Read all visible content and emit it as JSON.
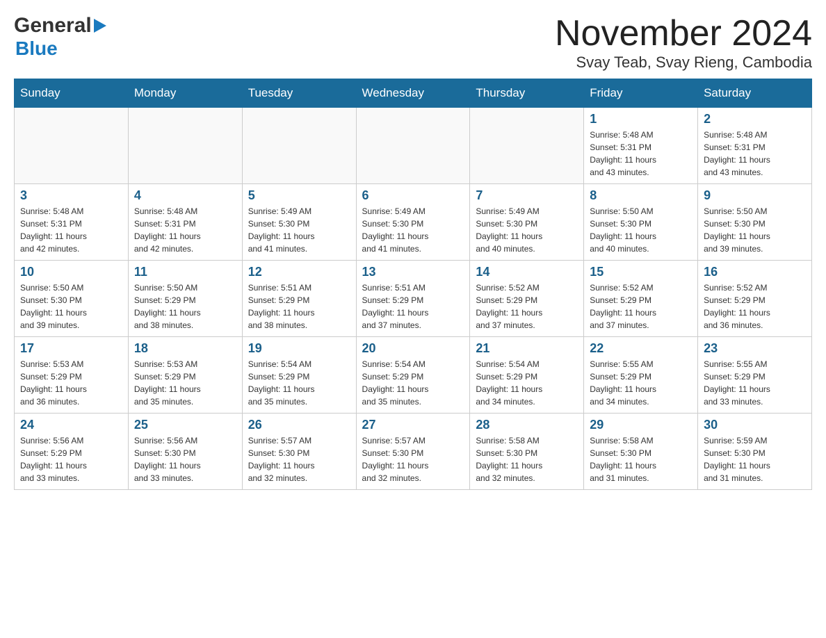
{
  "header": {
    "logo_general": "General",
    "logo_blue": "Blue",
    "title": "November 2024",
    "subtitle": "Svay Teab, Svay Rieng, Cambodia"
  },
  "calendar": {
    "days_of_week": [
      "Sunday",
      "Monday",
      "Tuesday",
      "Wednesday",
      "Thursday",
      "Friday",
      "Saturday"
    ],
    "weeks": [
      [
        {
          "day": "",
          "info": ""
        },
        {
          "day": "",
          "info": ""
        },
        {
          "day": "",
          "info": ""
        },
        {
          "day": "",
          "info": ""
        },
        {
          "day": "",
          "info": ""
        },
        {
          "day": "1",
          "info": "Sunrise: 5:48 AM\nSunset: 5:31 PM\nDaylight: 11 hours\nand 43 minutes."
        },
        {
          "day": "2",
          "info": "Sunrise: 5:48 AM\nSunset: 5:31 PM\nDaylight: 11 hours\nand 43 minutes."
        }
      ],
      [
        {
          "day": "3",
          "info": "Sunrise: 5:48 AM\nSunset: 5:31 PM\nDaylight: 11 hours\nand 42 minutes."
        },
        {
          "day": "4",
          "info": "Sunrise: 5:48 AM\nSunset: 5:31 PM\nDaylight: 11 hours\nand 42 minutes."
        },
        {
          "day": "5",
          "info": "Sunrise: 5:49 AM\nSunset: 5:30 PM\nDaylight: 11 hours\nand 41 minutes."
        },
        {
          "day": "6",
          "info": "Sunrise: 5:49 AM\nSunset: 5:30 PM\nDaylight: 11 hours\nand 41 minutes."
        },
        {
          "day": "7",
          "info": "Sunrise: 5:49 AM\nSunset: 5:30 PM\nDaylight: 11 hours\nand 40 minutes."
        },
        {
          "day": "8",
          "info": "Sunrise: 5:50 AM\nSunset: 5:30 PM\nDaylight: 11 hours\nand 40 minutes."
        },
        {
          "day": "9",
          "info": "Sunrise: 5:50 AM\nSunset: 5:30 PM\nDaylight: 11 hours\nand 39 minutes."
        }
      ],
      [
        {
          "day": "10",
          "info": "Sunrise: 5:50 AM\nSunset: 5:30 PM\nDaylight: 11 hours\nand 39 minutes."
        },
        {
          "day": "11",
          "info": "Sunrise: 5:50 AM\nSunset: 5:29 PM\nDaylight: 11 hours\nand 38 minutes."
        },
        {
          "day": "12",
          "info": "Sunrise: 5:51 AM\nSunset: 5:29 PM\nDaylight: 11 hours\nand 38 minutes."
        },
        {
          "day": "13",
          "info": "Sunrise: 5:51 AM\nSunset: 5:29 PM\nDaylight: 11 hours\nand 37 minutes."
        },
        {
          "day": "14",
          "info": "Sunrise: 5:52 AM\nSunset: 5:29 PM\nDaylight: 11 hours\nand 37 minutes."
        },
        {
          "day": "15",
          "info": "Sunrise: 5:52 AM\nSunset: 5:29 PM\nDaylight: 11 hours\nand 37 minutes."
        },
        {
          "day": "16",
          "info": "Sunrise: 5:52 AM\nSunset: 5:29 PM\nDaylight: 11 hours\nand 36 minutes."
        }
      ],
      [
        {
          "day": "17",
          "info": "Sunrise: 5:53 AM\nSunset: 5:29 PM\nDaylight: 11 hours\nand 36 minutes."
        },
        {
          "day": "18",
          "info": "Sunrise: 5:53 AM\nSunset: 5:29 PM\nDaylight: 11 hours\nand 35 minutes."
        },
        {
          "day": "19",
          "info": "Sunrise: 5:54 AM\nSunset: 5:29 PM\nDaylight: 11 hours\nand 35 minutes."
        },
        {
          "day": "20",
          "info": "Sunrise: 5:54 AM\nSunset: 5:29 PM\nDaylight: 11 hours\nand 35 minutes."
        },
        {
          "day": "21",
          "info": "Sunrise: 5:54 AM\nSunset: 5:29 PM\nDaylight: 11 hours\nand 34 minutes."
        },
        {
          "day": "22",
          "info": "Sunrise: 5:55 AM\nSunset: 5:29 PM\nDaylight: 11 hours\nand 34 minutes."
        },
        {
          "day": "23",
          "info": "Sunrise: 5:55 AM\nSunset: 5:29 PM\nDaylight: 11 hours\nand 33 minutes."
        }
      ],
      [
        {
          "day": "24",
          "info": "Sunrise: 5:56 AM\nSunset: 5:29 PM\nDaylight: 11 hours\nand 33 minutes."
        },
        {
          "day": "25",
          "info": "Sunrise: 5:56 AM\nSunset: 5:30 PM\nDaylight: 11 hours\nand 33 minutes."
        },
        {
          "day": "26",
          "info": "Sunrise: 5:57 AM\nSunset: 5:30 PM\nDaylight: 11 hours\nand 32 minutes."
        },
        {
          "day": "27",
          "info": "Sunrise: 5:57 AM\nSunset: 5:30 PM\nDaylight: 11 hours\nand 32 minutes."
        },
        {
          "day": "28",
          "info": "Sunrise: 5:58 AM\nSunset: 5:30 PM\nDaylight: 11 hours\nand 32 minutes."
        },
        {
          "day": "29",
          "info": "Sunrise: 5:58 AM\nSunset: 5:30 PM\nDaylight: 11 hours\nand 31 minutes."
        },
        {
          "day": "30",
          "info": "Sunrise: 5:59 AM\nSunset: 5:30 PM\nDaylight: 11 hours\nand 31 minutes."
        }
      ]
    ]
  }
}
